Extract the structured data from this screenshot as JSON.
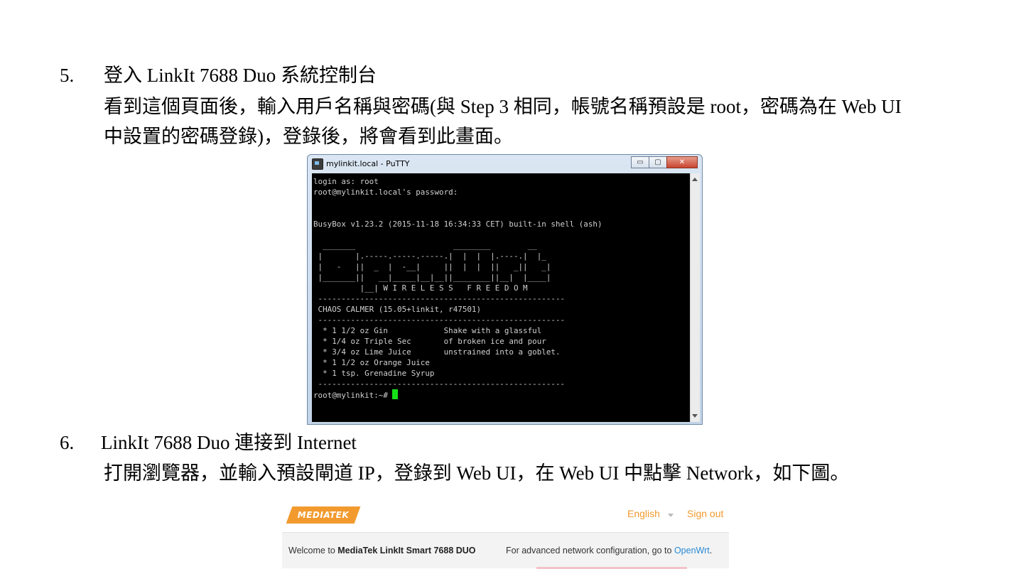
{
  "steps": [
    {
      "number": "5.",
      "heading": "登入 LinkIt 7688 Duo 系統控制台",
      "body_line1": "看到這個頁面後，輸入用戶名稱與密碼(與 Step 3 相同，帳號名稱預設是 root，密碼為在 Web UI",
      "body_line2": "中設置的密碼登錄)，登錄後，將會看到此畫面。"
    },
    {
      "number": "6.",
      "heading": "LinkIt 7688 Duo 連接到 Internet",
      "body_line1": "打開瀏覽器，並輸入預設閘道 IP，登錄到 Web UI，在 Web UI 中點擊 Network，如下圖。"
    }
  ],
  "putty": {
    "title": "mylinkit.local - PuTTY",
    "buttons": {
      "minimize": "▭",
      "maximize": "▢",
      "close": "✕"
    },
    "terminal_lines": [
      "login as: root",
      "root@mylinkit.local's password:",
      "",
      "",
      "BusyBox v1.23.2 (2015-11-18 16:34:33 CET) built-in shell (ash)",
      "",
      "  _______                     ________        __",
      " |       |.-----.-----.-----.|  |  |  |.----.|  |_",
      " |   -   ||  _  |  -__|     ||  |  |  ||   _||   _|",
      " |_______||   __|_____|__|__||________||__|  |____|",
      "          |__| W I R E L E S S   F R E E D O M",
      " -----------------------------------------------------",
      " CHAOS CALMER (15.05+linkit, r47501)",
      " -----------------------------------------------------",
      "  * 1 1/2 oz Gin            Shake with a glassful",
      "  * 1/4 oz Triple Sec       of broken ice and pour",
      "  * 3/4 oz Lime Juice       unstrained into a goblet.",
      "  * 1 1/2 oz Orange Juice",
      "  * 1 tsp. Grenadine Syrup",
      " -----------------------------------------------------"
    ],
    "prompt": "root@mylinkit:~# "
  },
  "webui": {
    "logo": "MEDIATEK",
    "language": "English",
    "sign_out": "Sign out",
    "welcome_prefix": "Welcome to ",
    "welcome_product": "MediaTek LinkIt Smart 7688 DUO",
    "advanced_prefix": "For advanced network configuration, go to ",
    "advanced_link": "OpenWrt",
    "advanced_suffix": "."
  },
  "colors": {
    "brand_orange": "#f29a2e",
    "link_blue": "#2a8ad4",
    "cursor_green": "#16e016"
  }
}
